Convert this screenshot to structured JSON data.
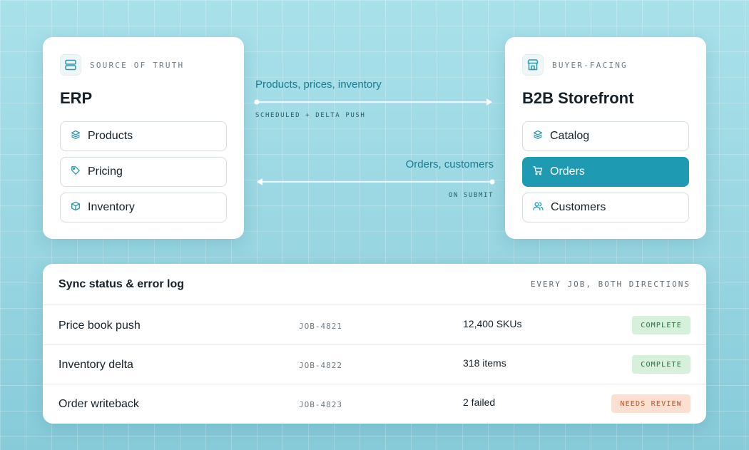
{
  "erp": {
    "eyebrow": "SOURCE OF TRUTH",
    "title": "ERP",
    "items": [
      {
        "label": "Products",
        "icon": "layers-icon"
      },
      {
        "label": "Pricing",
        "icon": "tag-icon"
      },
      {
        "label": "Inventory",
        "icon": "box-icon"
      }
    ]
  },
  "storefront": {
    "eyebrow": "BUYER-FACING",
    "title": "B2B Storefront",
    "items": [
      {
        "label": "Catalog",
        "icon": "layers-icon",
        "active": false
      },
      {
        "label": "Orders",
        "icon": "cart-icon",
        "active": true
      },
      {
        "label": "Customers",
        "icon": "users-icon",
        "active": false
      }
    ]
  },
  "flows": {
    "outbound": {
      "label": "Products, prices, inventory",
      "sub": "SCHEDULED + DELTA PUSH"
    },
    "inbound": {
      "label": "Orders, customers",
      "sub": "ON SUBMIT"
    }
  },
  "log": {
    "title": "Sync status & error log",
    "caption": "EVERY JOB, BOTH DIRECTIONS",
    "rows": [
      {
        "name": "Price book push",
        "job": "JOB-4821",
        "count": "12,400 SKUs",
        "status": "COMPLETE"
      },
      {
        "name": "Inventory delta",
        "job": "JOB-4822",
        "count": "318 items",
        "status": "COMPLETE"
      },
      {
        "name": "Order writeback",
        "job": "JOB-4823",
        "count": "2 failed",
        "status": "NEEDS REVIEW"
      }
    ]
  },
  "colors": {
    "accent": "#1f9ab3",
    "flow_text": "#1a7b90",
    "ok_bg": "#d6f0dc",
    "warn_bg": "#fbe0d2"
  }
}
